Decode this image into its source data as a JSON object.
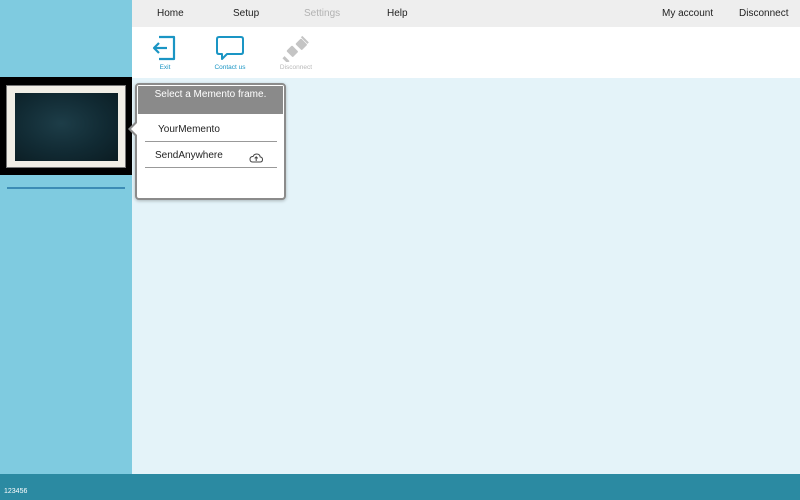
{
  "nav": {
    "home": "Home",
    "setup": "Setup",
    "settings": "Settings",
    "help": "Help",
    "my_account": "My account",
    "disconnect": "Disconnect"
  },
  "toolbar": {
    "exit": "Exit",
    "contact_us": "Contact us",
    "disconnect": "Disconnect"
  },
  "popup": {
    "title": "Select a Memento frame.",
    "items": [
      {
        "label": "YourMemento",
        "icon": ""
      },
      {
        "label": "SendAnywhere",
        "icon": "cloud-upload-icon"
      }
    ]
  },
  "footer": {
    "id": "123456"
  },
  "colors": {
    "sidebar": "#7fcbe0",
    "content_bg": "#e4f3f9",
    "footer": "#2b8aa2",
    "accent": "#1a95c4",
    "popup_header": "#8a8a8a"
  }
}
